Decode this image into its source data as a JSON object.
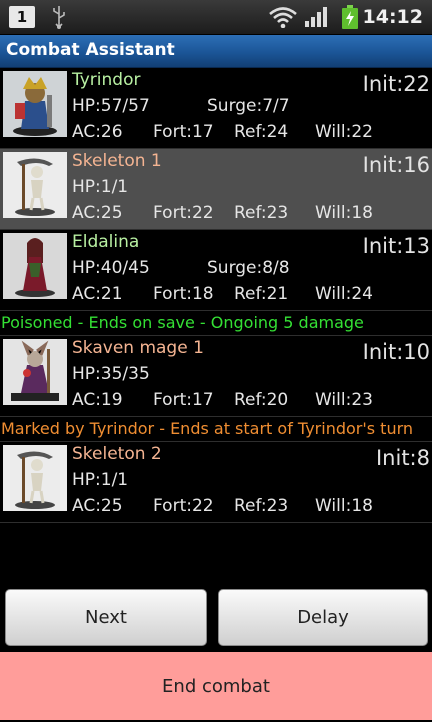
{
  "status_bar": {
    "notification_count": "1",
    "time": "14:12",
    "icons": [
      "usb-icon",
      "wifi-icon",
      "signal-icon",
      "battery-charging-icon"
    ]
  },
  "app": {
    "title": "Combat Assistant"
  },
  "colors": {
    "player_name": "#b8f0a2",
    "monster_name": "#f4b492",
    "effect_save": "#34e034",
    "effect_mark": "#f08e32",
    "selected_row": "#4f4f4f",
    "end_combat_bg": "#ff9d9a"
  },
  "combatants": [
    {
      "name": "Tyrindor",
      "type": "player",
      "init": "Init:22",
      "hp": "HP:57/57",
      "surge": "Surge:7/7",
      "ac": "AC:26",
      "fort": "Fort:17",
      "ref": "Ref:24",
      "will": "Will:22",
      "selected": false
    },
    {
      "name": "Skeleton 1",
      "type": "monster",
      "init": "Init:16",
      "hp": "HP:1/1",
      "surge": "",
      "ac": "AC:25",
      "fort": "Fort:22",
      "ref": "Ref:23",
      "will": "Will:18",
      "selected": true
    },
    {
      "name": "Eldalina",
      "type": "player",
      "init": "Init:13",
      "hp": "HP:40/45",
      "surge": "Surge:8/8",
      "ac": "AC:21",
      "fort": "Fort:18",
      "ref": "Ref:21",
      "will": "Will:24",
      "selected": false,
      "effect": "Poisoned - Ends on save - Ongoing 5 damage"
    },
    {
      "name": "Skaven mage 1",
      "type": "monster",
      "init": "Init:10",
      "hp": "HP:35/35",
      "surge": "",
      "ac": "AC:19",
      "fort": "Fort:17",
      "ref": "Ref:20",
      "will": "Will:23",
      "selected": false,
      "effect": "Marked by Tyrindor - Ends at start of Tyrindor's turn"
    },
    {
      "name": "Skeleton 2",
      "type": "monster",
      "init": "Init:8",
      "hp": "HP:1/1",
      "surge": "",
      "ac": "AC:25",
      "fort": "Fort:22",
      "ref": "Ref:23",
      "will": "Will:18",
      "selected": false
    }
  ],
  "buttons": {
    "next": "Next",
    "delay": "Delay",
    "end_combat": "End combat"
  }
}
